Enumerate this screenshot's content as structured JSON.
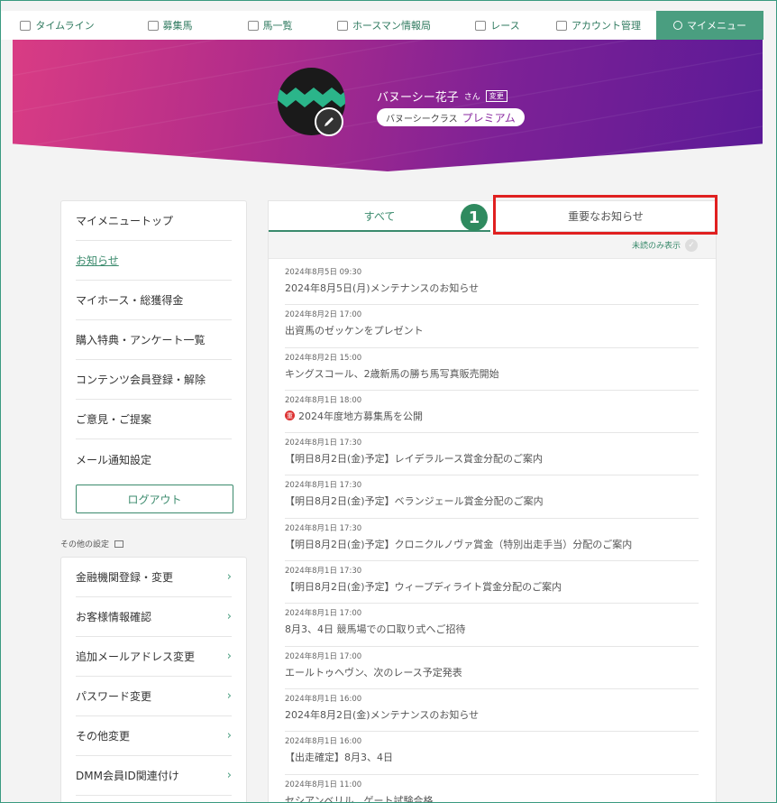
{
  "nav": [
    {
      "label": "タイムライン",
      "icon": "timeline-icon"
    },
    {
      "label": "募集馬",
      "icon": "horse-list-icon"
    },
    {
      "label": "馬一覧",
      "icon": "horse-icon"
    },
    {
      "label": "ホースマン情報局",
      "icon": "info-icon"
    },
    {
      "label": "レース",
      "icon": "flag-icon"
    },
    {
      "label": "アカウント管理",
      "icon": "account-icon"
    },
    {
      "label": "マイメニュー",
      "icon": "user-icon",
      "active": true
    }
  ],
  "profile": {
    "name": "バヌーシー花子",
    "honorific": "さん",
    "change_label": "変更",
    "class_label": "バヌーシークラス",
    "class_rank": "プレミアム"
  },
  "sidebar": {
    "items": [
      {
        "label": "マイメニュートップ"
      },
      {
        "label": "お知らせ",
        "active": true
      },
      {
        "label": "マイホース・総獲得金"
      },
      {
        "label": "購入特典・アンケート一覧"
      },
      {
        "label": "コンテンツ会員登録・解除"
      },
      {
        "label": "ご意見・ご提案"
      },
      {
        "label": "メール通知設定"
      }
    ],
    "logout_label": "ログアウト",
    "other_label": "その他の設定",
    "other_items": [
      {
        "label": "金融機関登録・変更"
      },
      {
        "label": "お客様情報確認"
      },
      {
        "label": "追加メールアドレス変更"
      },
      {
        "label": "パスワード変更"
      },
      {
        "label": "その他変更"
      },
      {
        "label": "DMM会員ID関連付け"
      }
    ]
  },
  "tabs": {
    "all": "すべて",
    "important": "重要なお知らせ"
  },
  "step_number": "1",
  "filter": {
    "unread_label": "未読のみ表示"
  },
  "news": [
    {
      "date": "2024年8月5日 09:30",
      "title": "2024年8月5日(月)メンテナンスのお知らせ"
    },
    {
      "date": "2024年8月2日 17:00",
      "title": "出資馬のゼッケンをプレゼント"
    },
    {
      "date": "2024年8月2日 15:00",
      "title": "キングスコール、2歳新馬の勝ち馬写真販売開始"
    },
    {
      "date": "2024年8月1日 18:00",
      "title": "2024年度地方募集馬を公開",
      "important": true,
      "important_mark": "重"
    },
    {
      "date": "2024年8月1日 17:30",
      "title": "【明日8月2日(金)予定】レイデラルース賞金分配のご案内"
    },
    {
      "date": "2024年8月1日 17:30",
      "title": "【明日8月2日(金)予定】ベランジェール賞金分配のご案内"
    },
    {
      "date": "2024年8月1日 17:30",
      "title": "【明日8月2日(金)予定】クロニクルノヴァ賞金（特別出走手当）分配のご案内"
    },
    {
      "date": "2024年8月1日 17:30",
      "title": "【明日8月2日(金)予定】ウィープディライト賞金分配のご案内"
    },
    {
      "date": "2024年8月1日 17:00",
      "title": "8月3、4日 競馬場での口取り式へご招待"
    },
    {
      "date": "2024年8月1日 17:00",
      "title": "エールトゥヘヴン、次のレース予定発表"
    },
    {
      "date": "2024年8月1日 16:00",
      "title": "2024年8月2日(金)メンテナンスのお知らせ"
    },
    {
      "date": "2024年8月1日 16:00",
      "title": "【出走確定】8月3、4日"
    },
    {
      "date": "2024年8月1日 11:00",
      "title": "セシアンベリル、ゲート試験合格"
    }
  ]
}
